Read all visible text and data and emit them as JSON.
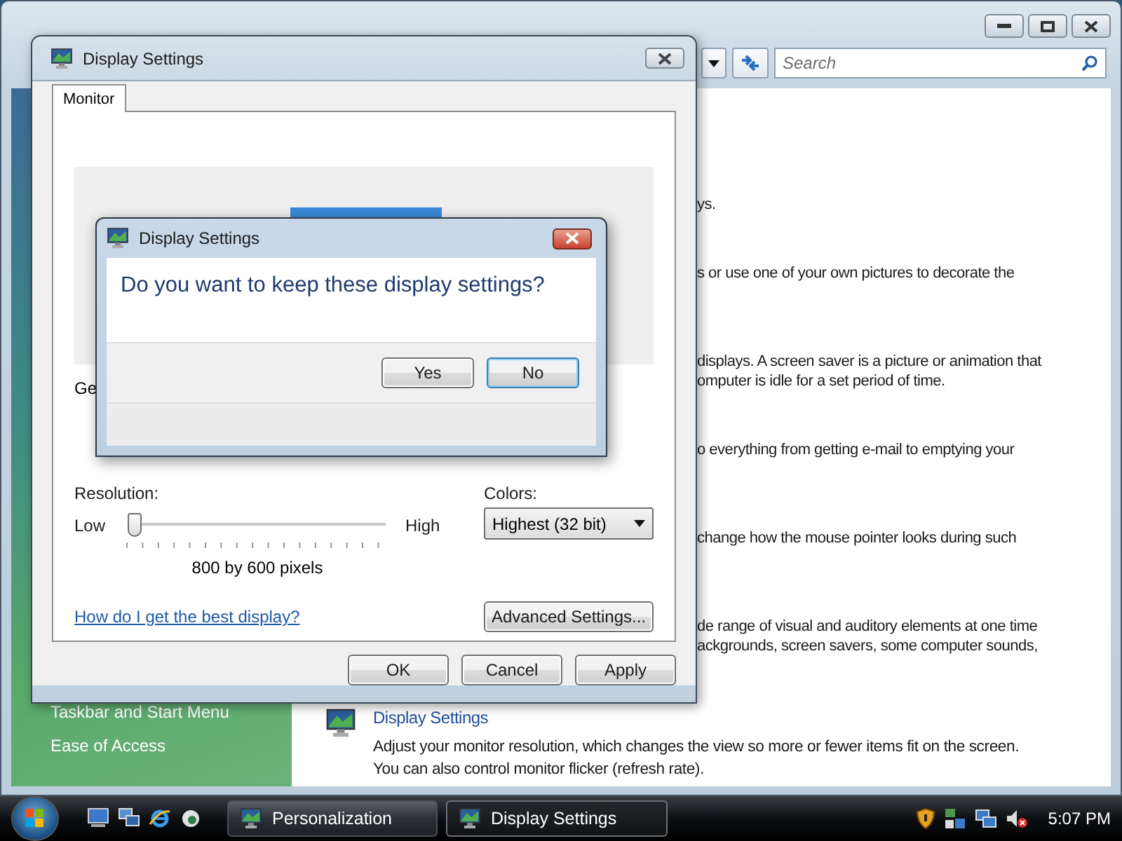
{
  "background_window": {
    "search": {
      "placeholder": "Search"
    },
    "sidebar": {
      "items": [
        {
          "label": "Taskbar and Start Menu"
        },
        {
          "label": "Ease of Access"
        }
      ]
    },
    "content": {
      "fragments": [
        [
          "ys."
        ],
        [
          "s or use one of your own pictures to decorate the"
        ],
        [
          "displays. A screen saver is a picture or animation that",
          "omputer is idle for a set period of time."
        ],
        [
          "o everything from getting e-mail to emptying your"
        ],
        [
          "change how the mouse pointer looks during such"
        ],
        [
          "de range of visual and auditory elements at one time",
          "ackgrounds, screen savers, some computer sounds,"
        ]
      ],
      "section": {
        "title": "Display Settings",
        "description": [
          "Adjust your monitor resolution, which changes the view so more or fewer items fit on the screen.",
          "You can also control monitor flicker (refresh rate)."
        ]
      }
    }
  },
  "display_settings": {
    "title": "Display Settings",
    "tabs": [
      {
        "label": "Monitor",
        "selected": true
      }
    ],
    "preview_label": "Ge",
    "resolution": {
      "label": "Resolution:",
      "low": "Low",
      "high": "High",
      "level": 0,
      "reading": "800 by 600 pixels"
    },
    "colors": {
      "label": "Colors:",
      "value": "Highest (32 bit)"
    },
    "help_link": "How do I get the best display?",
    "advanced_button": "Advanced Settings...",
    "buttons": [
      "OK",
      "Cancel",
      "Apply"
    ]
  },
  "message_box": {
    "title": "Display Settings",
    "question": "Do you want to keep these display settings?",
    "buttons": [
      {
        "label": "Yes",
        "selected": false
      },
      {
        "label": "No",
        "selected": true
      }
    ]
  },
  "taskbar": {
    "tasks": [
      {
        "label": "Personalization",
        "selected": false
      },
      {
        "label": "Display Settings",
        "selected": true
      }
    ],
    "clock": "5:07 PM"
  }
}
